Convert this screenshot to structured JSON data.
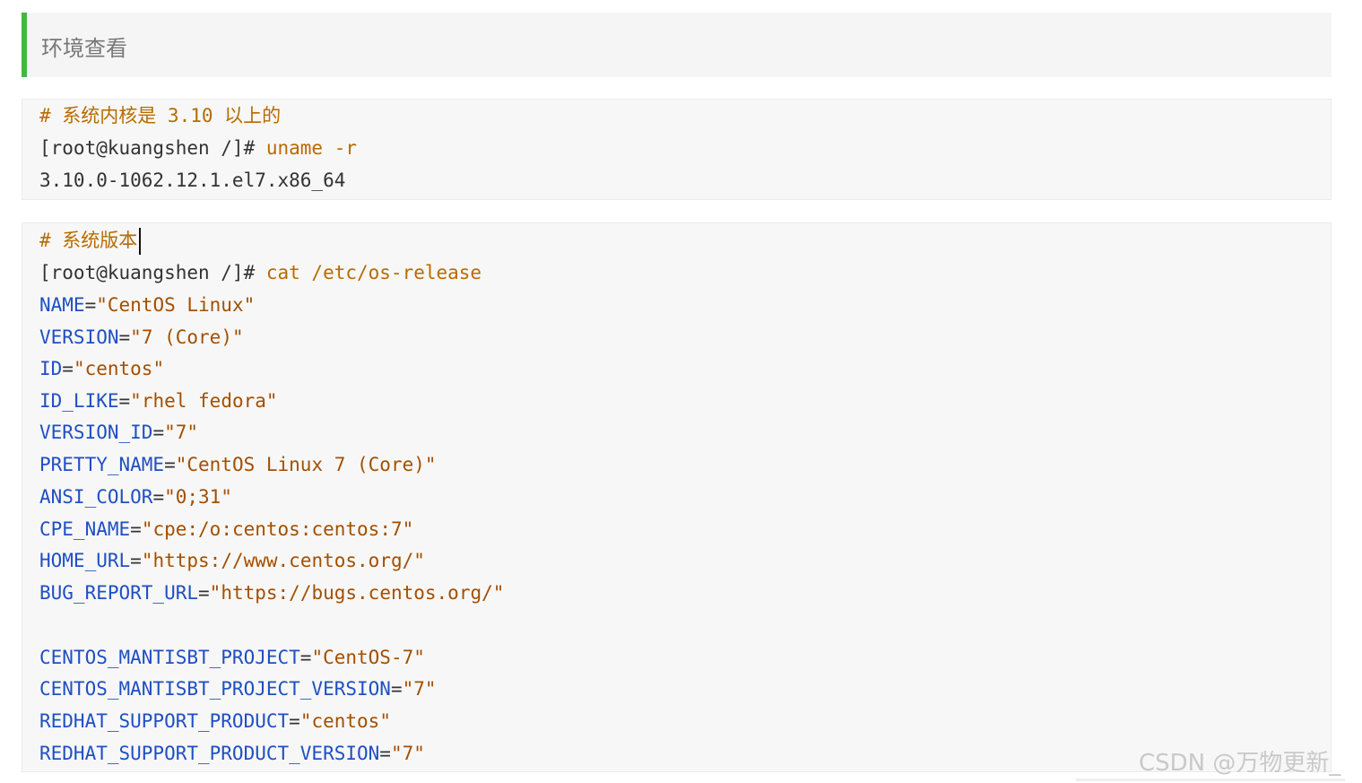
{
  "quote": {
    "text": "环境查看"
  },
  "block1": {
    "comment": "# 系统内核是 3.10 以上的",
    "prompt": "[root@kuangshen /]#",
    "command": " uname -r",
    "output": "3.10.0-1062.12.1.el7.x86_64"
  },
  "block2": {
    "comment": "# 系统版本",
    "prompt": "[root@kuangshen /]#",
    "command": " cat /etc/os-release",
    "lines": [
      {
        "key": "NAME",
        "value": "\"CentOS Linux\""
      },
      {
        "key": "VERSION",
        "value": "\"7 (Core)\""
      },
      {
        "key": "ID",
        "value": "\"centos\""
      },
      {
        "key": "ID_LIKE",
        "value": "\"rhel fedora\""
      },
      {
        "key": "VERSION_ID",
        "value": "\"7\""
      },
      {
        "key": "PRETTY_NAME",
        "value": "\"CentOS Linux 7 (Core)\""
      },
      {
        "key": "ANSI_COLOR",
        "value": "\"0;31\""
      },
      {
        "key": "CPE_NAME",
        "value": "\"cpe:/o:centos:centos:7\""
      },
      {
        "key": "HOME_URL",
        "value": "\"https://www.centos.org/\""
      },
      {
        "key": "BUG_REPORT_URL",
        "value": "\"https://bugs.centos.org/\""
      },
      {
        "key": "CENTOS_MANTISBT_PROJECT",
        "value": "\"CentOS-7\""
      },
      {
        "key": "CENTOS_MANTISBT_PROJECT_VERSION",
        "value": "\"7\""
      },
      {
        "key": "REDHAT_SUPPORT_PRODUCT",
        "value": "\"centos\""
      },
      {
        "key": "REDHAT_SUPPORT_PRODUCT_VERSION",
        "value": "\"7\""
      }
    ]
  },
  "watermark": "CSDN @万物更新_",
  "colors": {
    "accent_bar": "#42b843",
    "comment": "#b76b00",
    "key": "#1f4fc4",
    "value": "#a34f00"
  }
}
